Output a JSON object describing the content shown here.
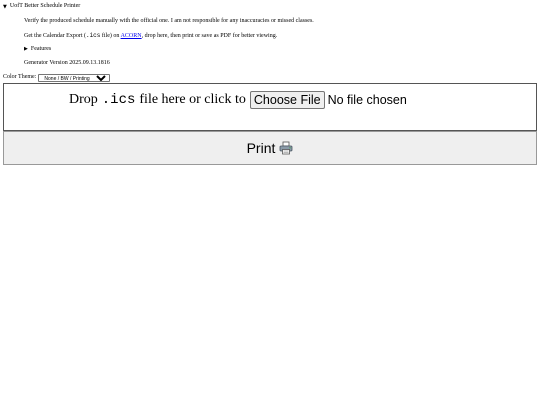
{
  "details": {
    "expanded_marker": "▼",
    "title": "UofT Better Schedule Printer"
  },
  "lines": {
    "disclaimer": "Verify the produced schedule manually with the official one. I am not responsible for any inaccuracies or missed classes.",
    "export_prefix": "Get the Calendar Export (",
    "export_code": ".ics",
    "export_mid": " file) on ",
    "acorn_link": "ACORN",
    "export_suffix": ", drop here, then print or save as PDF for better viewing.",
    "features_marker": "▶",
    "features_label": "Features",
    "version": "Generator Version 2025.09.13.1816"
  },
  "theme": {
    "label": "Color Theme:",
    "selected": "None / BW / Printing"
  },
  "dropzone": {
    "prefix": "Drop",
    "code": ".ics",
    "suffix": "file here or click to",
    "choose_label": "Choose File",
    "status": "No file chosen"
  },
  "print": {
    "label": "Print",
    "icon": "printer-icon"
  }
}
